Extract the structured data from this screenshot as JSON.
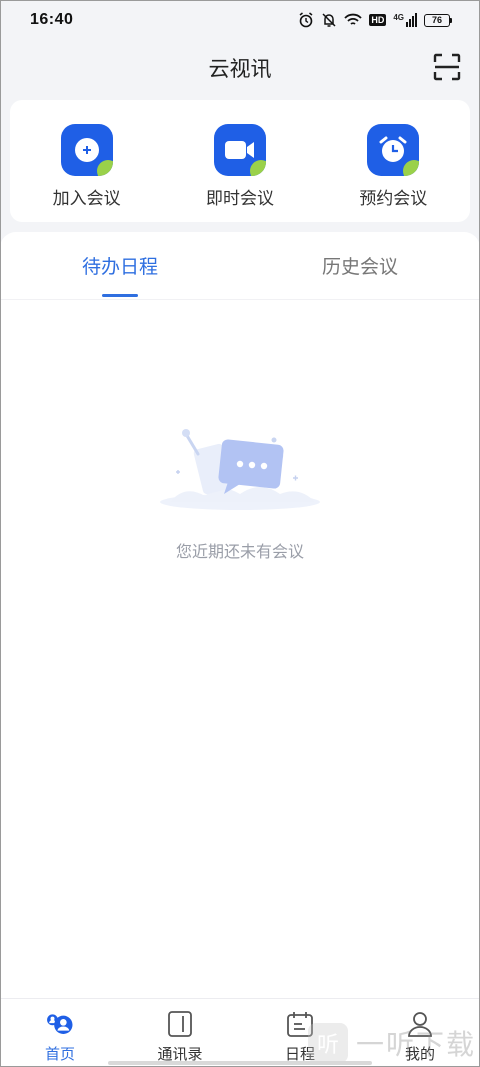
{
  "status_bar": {
    "time": "16:40",
    "network": "4G",
    "hd": "HD",
    "battery": "76"
  },
  "header": {
    "title": "云视讯",
    "scan_icon": "scan-icon"
  },
  "quick_actions": [
    {
      "label": "加入会议",
      "icon": "plus-circle-icon"
    },
    {
      "label": "即时会议",
      "icon": "video-camera-icon"
    },
    {
      "label": "预约会议",
      "icon": "alarm-clock-icon"
    }
  ],
  "tabs": [
    {
      "label": "待办日程",
      "active": true
    },
    {
      "label": "历史会议",
      "active": false
    }
  ],
  "empty_state": {
    "message": "您近期还未有会议"
  },
  "bottom_nav": [
    {
      "label": "首页",
      "icon": "home-people-icon",
      "active": true
    },
    {
      "label": "通讯录",
      "icon": "contacts-book-icon",
      "active": false
    },
    {
      "label": "日程",
      "icon": "calendar-icon",
      "active": false
    },
    {
      "label": "我的",
      "icon": "person-icon",
      "active": false
    }
  ],
  "watermark": {
    "badge": "听",
    "text": "一听下载"
  },
  "colors": {
    "primary": "#1f5fe6",
    "accent_green": "#9ad14a",
    "active_tab": "#2f6fe0",
    "background": "#f3f4f7"
  }
}
